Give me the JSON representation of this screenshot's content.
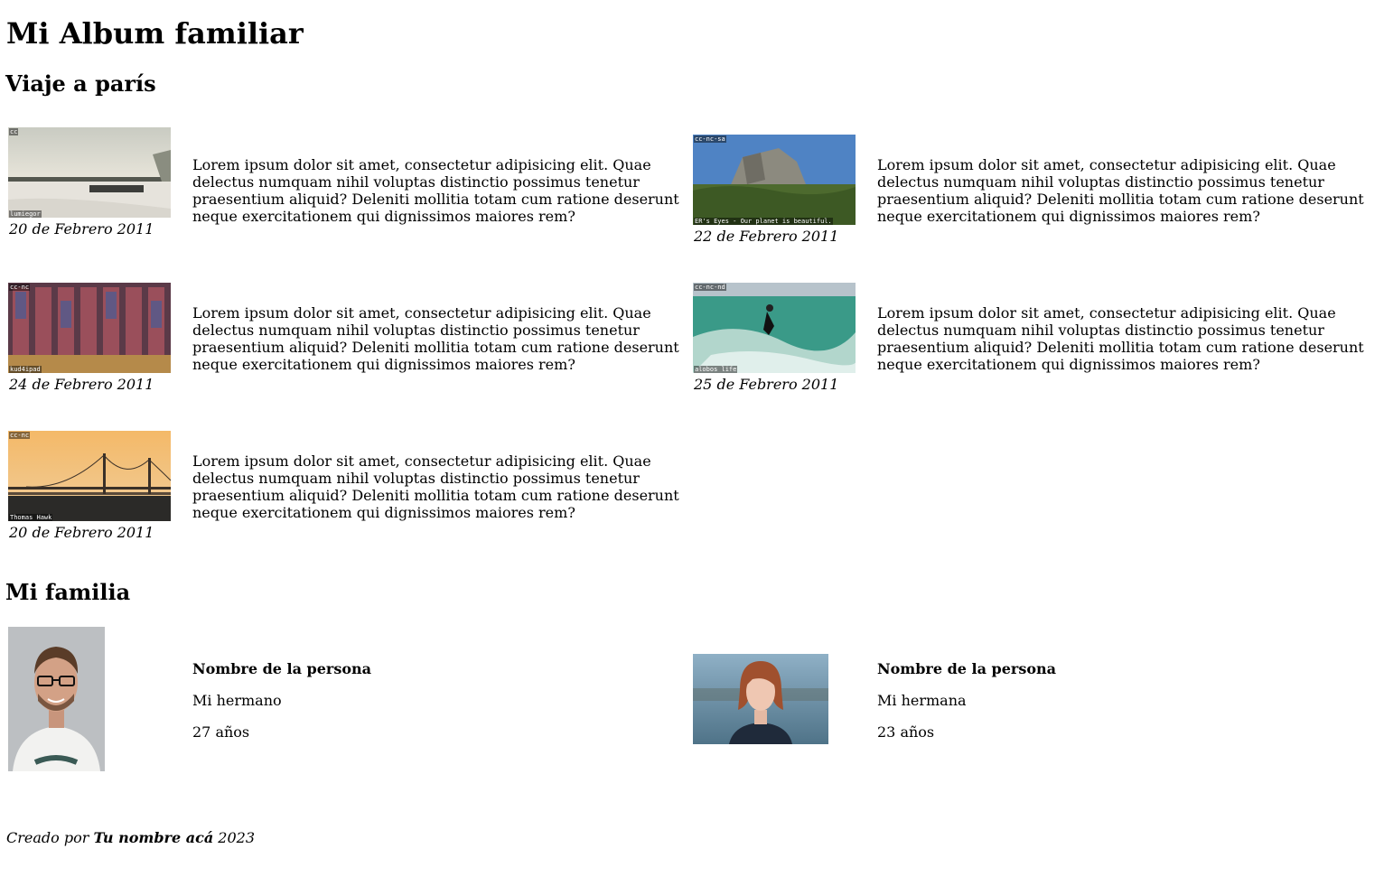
{
  "title": "Mi Album familiar",
  "section_trip": "Viaje a parís",
  "photos": [
    {
      "date": "20 de Febrero 2011",
      "text": "Lorem ipsum dolor sit amet, consectetur adipisicing elit. Quae delectus numquam nihil voluptas distinctio possimus tenetur praesentium aliquid? Deleniti mollitia totam cum ratione deserunt neque exercitationem qui dignissimos maiores rem?",
      "license": "cc",
      "author": "lumiegor"
    },
    {
      "date": "22 de Febrero 2011",
      "text": "Lorem ipsum dolor sit amet, consectetur adipisicing elit. Quae delectus numquam nihil voluptas distinctio possimus tenetur praesentium aliquid? Deleniti mollitia totam cum ratione deserunt neque exercitationem qui dignissimos maiores rem?",
      "license": "cc-nc-sa",
      "author": "ER's Eyes - Our planet is beautiful."
    },
    {
      "date": "24 de Febrero 2011",
      "text": "Lorem ipsum dolor sit amet, consectetur adipisicing elit. Quae delectus numquam nihil voluptas distinctio possimus tenetur praesentium aliquid? Deleniti mollitia totam cum ratione deserunt neque exercitationem qui dignissimos maiores rem?",
      "license": "cc-nc",
      "author": "kud4ipad"
    },
    {
      "date": "25 de Febrero 2011",
      "text": "Lorem ipsum dolor sit amet, consectetur adipisicing elit. Quae delectus numquam nihil voluptas distinctio possimus tenetur praesentium aliquid? Deleniti mollitia totam cum ratione deserunt neque exercitationem qui dignissimos maiores rem?",
      "license": "cc-nc-nd",
      "author": "alobos life"
    },
    {
      "date": "20 de Febrero 2011",
      "text": "Lorem ipsum dolor sit amet, consectetur adipisicing elit. Quae delectus numquam nihil voluptas distinctio possimus tenetur praesentium aliquid? Deleniti mollitia totam cum ratione deserunt neque exercitationem qui dignissimos maiores rem?",
      "license": "cc-nc",
      "author": "Thomas Hawk"
    }
  ],
  "section_family": "Mi familia",
  "family": [
    {
      "name": "Nombre de la persona",
      "relation": "Mi hermano",
      "age": "27 años"
    },
    {
      "name": "Nombre de la persona",
      "relation": "Mi hermana",
      "age": "23 años"
    }
  ],
  "footer": {
    "prefix": "Creado por",
    "name": "Tu nombre acá",
    "year": "2023"
  }
}
